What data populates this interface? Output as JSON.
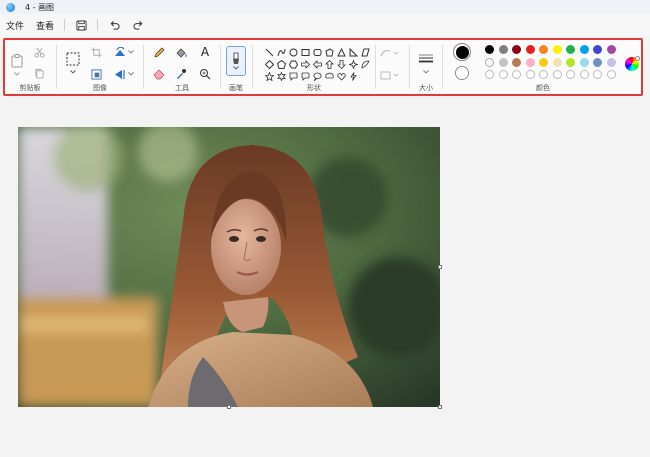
{
  "window": {
    "title": "4 - 画图"
  },
  "menu": {
    "file": "文件",
    "view": "查看"
  },
  "ribbon": {
    "groups": {
      "clipboard": "剪贴板",
      "image": "图像",
      "tools": "工具",
      "brushes": "画笔",
      "shapes": "形状",
      "size": "大小",
      "colors": "颜色"
    },
    "tools_text_glyph": "A"
  },
  "colors": {
    "primary": "#000000",
    "secondary": "#ffffff",
    "accent_border": "#e23a3a",
    "palette_row1": [
      "#000000",
      "#7f7f7f",
      "#880015",
      "#ed1c24",
      "#ff7f27",
      "#fff200",
      "#22b14c",
      "#00a2e8",
      "#3f48cc",
      "#a349a4"
    ],
    "palette_row2": [
      "#ffffff",
      "#c3c3c3",
      "#b97a57",
      "#ffaec9",
      "#ffc90e",
      "#efe4b0",
      "#b5e61d",
      "#99d9ea",
      "#7092be",
      "#c8bfe7"
    ]
  },
  "icons": {
    "app": "paint-app-icon",
    "save": "save-icon",
    "undo": "undo-icon",
    "redo": "redo-icon"
  }
}
